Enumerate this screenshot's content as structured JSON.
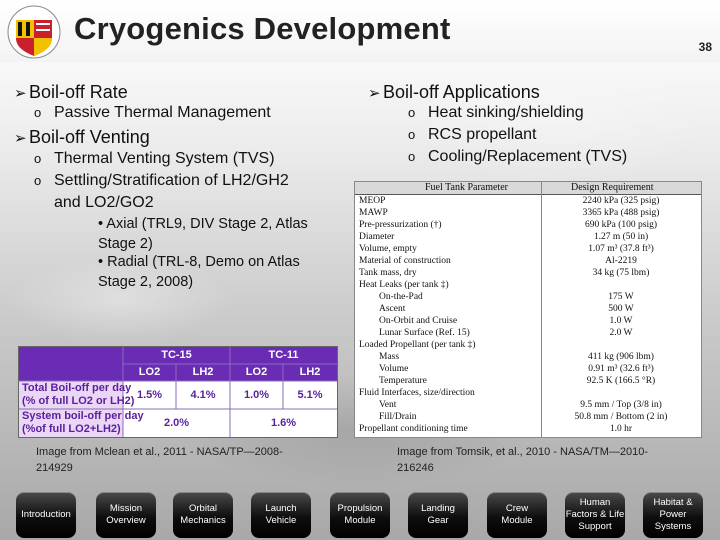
{
  "slide": {
    "title": "Cryogenics Development",
    "page_number": "38"
  },
  "left": {
    "boiloff_rate": "Boil-off Rate",
    "passive": "Passive Thermal Management",
    "boiloff_venting": "Boil-off Venting",
    "tvs": "Thermal Venting System (TVS)",
    "settling_line1": "Settling/Stratification of LH2/GH2",
    "settling_line2": "and LO2/GO2",
    "axial_line1": "• Axial (TRL9, DIV Stage 2, Atlas",
    "axial_line2": "Stage 2)",
    "radial_line1": "• Radial (TRL-8,  Demo on Atlas",
    "radial_line2": "Stage 2, 2008)"
  },
  "right": {
    "applications": "Boil-off Applications",
    "items": [
      "Heat sinking/shielding",
      "RCS propellant",
      "Cooling/Replacement (TVS)"
    ]
  },
  "spec_table": {
    "headers": [
      "Fuel Tank Parameter",
      "Design Requirement"
    ],
    "rows": [
      [
        "MEOP",
        "2240 kPa (325 psig)"
      ],
      [
        "MAWP",
        "3365 kPa (488 psig)"
      ],
      [
        "Pre-pressurization (†)",
        "690 kPa (100 psig)"
      ],
      [
        "Diameter",
        "1.27 m (50 in)"
      ],
      [
        "Volume, empty",
        "1.07 m³ (37.8 ft³)"
      ],
      [
        "Material of construction",
        "Al-2219"
      ],
      [
        "Tank mass, dry",
        "34 kg (75 lbm)"
      ],
      [
        "Heat Leaks (per tank ‡)",
        ""
      ],
      [
        "On-the-Pad",
        "175 W"
      ],
      [
        "Ascent",
        "500 W"
      ],
      [
        "On-Orbit and Cruise",
        "1.0 W"
      ],
      [
        "Lunar Surface (Ref. 15)",
        "2.0 W"
      ],
      [
        "Loaded Propellant (per tank ‡)",
        ""
      ],
      [
        "Mass",
        "411 kg (906 lbm)"
      ],
      [
        "Volume",
        "0.91 m³ (32.6 ft³)"
      ],
      [
        "Temperature",
        "92.5 K (166.5 °R)"
      ],
      [
        "Fluid Interfaces, size/direction",
        ""
      ],
      [
        "Vent",
        "9.5 mm / Top (3/8 in)"
      ],
      [
        "Fill/Drain",
        "50.8 mm / Bottom (2 in)"
      ],
      [
        "Propellant conditioning time",
        "1.0 hr"
      ]
    ]
  },
  "boiloff_table": {
    "groups": [
      "TC-15",
      "TC-11"
    ],
    "subheaders": [
      "LO2",
      "LH2",
      "LO2",
      "LH2"
    ],
    "row1_label_line1": "Total Boil-off per day",
    "row1_label_line2": "(% of full LO2 or LH2)",
    "row1_values": [
      "1.5%",
      "4.1%",
      "1.0%",
      "5.1%"
    ],
    "row2_label_line1": "System boil-off per day",
    "row2_label_line2": "(%of full LO2+LH2)",
    "row2_values": [
      "2.0%",
      "1.6%"
    ]
  },
  "captions": {
    "left_line1": "Image from Mclean et al., 2011 - NASA/TP—2008-",
    "left_line2": "214929",
    "right_line1": "Image from Tomsik, et al., 2010 - NASA/TM—2010-",
    "right_line2": "216246"
  },
  "nav": [
    {
      "line1": "Introduction",
      "line2": ""
    },
    {
      "line1": "Mission",
      "line2": "Overview"
    },
    {
      "line1": "Orbital",
      "line2": "Mechanics"
    },
    {
      "line1": "Launch",
      "line2": "Vehicle"
    },
    {
      "line1": "Propulsion",
      "line2": "Module"
    },
    {
      "line1": "Landing",
      "line2": "Gear"
    },
    {
      "line1": "Crew",
      "line2": "Module"
    },
    {
      "line1": "Human",
      "line2": "Factors & Life Support"
    },
    {
      "line1": "Habitat &",
      "line2": "Power Systems"
    }
  ],
  "colors": {
    "table_header": "#6a2cb4",
    "table_row_label": "#ead7f5",
    "accent_text": "#5a1f9c",
    "logo_red": "#cc1f2d",
    "logo_gold": "#f2c200"
  }
}
